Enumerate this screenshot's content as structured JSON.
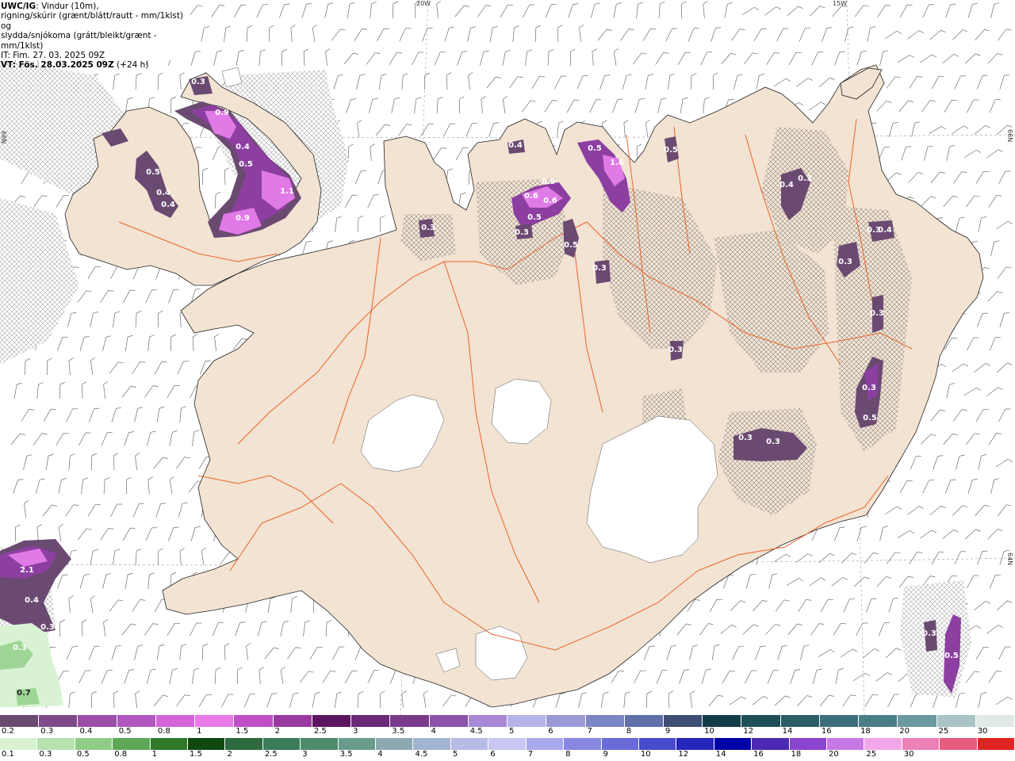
{
  "info": {
    "title": "UWC/IG",
    "line1_rest": ": Vindur (10m),",
    "line2": "rigning/skúrir (grænt/blátt/rautt - mm/1klst) og",
    "line3": "slydda/snjókoma (grátt/bleikt/grænt - mm/1klst)",
    "line4": "IT: Fim. 27. 03. 2025 09Z",
    "line5_bold": "VT: Fös. 28.03.2025 09Z",
    "line5_rest": " (+24 h)"
  },
  "graticule": {
    "lon_labels": [
      "20W",
      "15W"
    ],
    "lat_labels": [
      "66N",
      "66N",
      "64N"
    ]
  },
  "precip_labels": [
    "0.3",
    "0.9",
    "0.4",
    "0.5",
    "1.1",
    "0.9",
    "0.5",
    "0.4",
    "0.4",
    "0.3",
    "0.4",
    "0.6",
    "0.6",
    "0.5",
    "0.3",
    "0.9",
    "0.3",
    "0.5",
    "1.6",
    "0.5",
    "0.5",
    "0.3",
    "0.4",
    "0.3",
    "0.3",
    "0.3",
    "0.4",
    "0.3",
    "0.3",
    "0.5",
    "0.3",
    "0.3",
    "0.3",
    "2.1",
    "0.4",
    "0.3",
    "0.7",
    "0.3",
    "0.5"
  ],
  "legend_snow": {
    "colors": [
      "#6b4a72",
      "#7d4a8a",
      "#9a4ea8",
      "#b256c0",
      "#d364d9",
      "#e97be8",
      "#c050c8",
      "#9a3aa0",
      "#5c1560",
      "#6a2a78",
      "#7a3a8c",
      "#8a54a8",
      "#a889d6",
      "#b6b2ea",
      "#9c9ad6",
      "#7c86c6",
      "#6070a8",
      "#3e4e74",
      "#143c48",
      "#1f5058",
      "#2c5e68",
      "#3a6e7a",
      "#4a7e86",
      "#6a9a9e",
      "#a8c4c6",
      "#e0e8e8"
    ],
    "ticks": [
      "0.2",
      "0.3",
      "0.4",
      "0.5",
      "0.8",
      "1",
      "1.5",
      "2",
      "2.5",
      "3",
      "3.5",
      "4",
      "4.5",
      "5",
      "6",
      "7",
      "8",
      "9",
      "10",
      "12",
      "14",
      "16",
      "18",
      "20",
      "25",
      "30"
    ]
  },
  "legend_rain": {
    "colors": [
      "#d9f2d4",
      "#b7e2ae",
      "#8fcc86",
      "#5ca856",
      "#2e7a2a",
      "#0e4a10",
      "#2e6a40",
      "#3c7c58",
      "#4e8c6c",
      "#6a9c8c",
      "#8aaab0",
      "#a2b4d2",
      "#b6bce6",
      "#c8c8f2",
      "#a8aaee",
      "#8888e4",
      "#6a6ad8",
      "#4a4acc",
      "#2626bc",
      "#0000a8",
      "#4a2ab2",
      "#8a44d0",
      "#c878e4",
      "#f2a8e8",
      "#ec80b8",
      "#e85c80",
      "#e02424"
    ],
    "ticks": [
      "0.1",
      "0.3",
      "0.5",
      "0.8",
      "1",
      "1.5",
      "2",
      "2.5",
      "3",
      "3.5",
      "4",
      "4.5",
      "5",
      "6",
      "7",
      "8",
      "9",
      "10",
      "12",
      "14",
      "16",
      "18",
      "20",
      "25",
      "30"
    ]
  },
  "colors": {
    "land": "#f2e3d3",
    "glacier": "#ffffff",
    "roads": "#e8642a",
    "precip_light": "#6b4a72",
    "precip_mid": "#8c3fa0",
    "precip_heavy": "#e07ae6",
    "rain_light": "#d9f2d4",
    "rain_mid": "#9ed695"
  }
}
